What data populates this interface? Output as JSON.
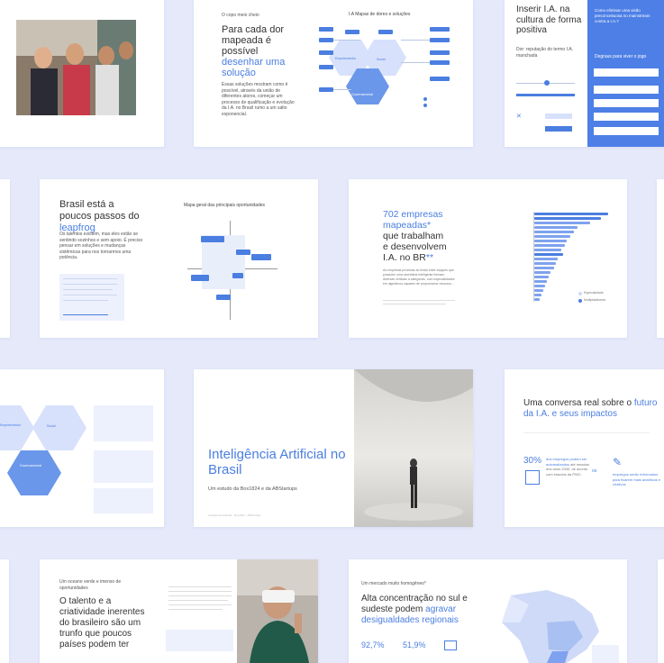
{
  "row1": {
    "card2": {
      "kicker": "O copo meio cheio",
      "title_a": "Para cada dor mapeada é possível ",
      "title_b": "desenhar uma solução",
      "body": "Essas soluções mostram como é possível, através da união de diferentes atores, começar um processo de qualificação e evolução da I.A. no Brasil rumo a um salto exponencial.",
      "map_title": "I.A Mapas de dores e soluções",
      "hex_labels": [
        "Empreendedor",
        "Social",
        "Governamental"
      ]
    },
    "card3": {
      "title": "Inserir I.A. na cultura de forma positiva",
      "sub": "Dor: reputação do termo I.A. manchada",
      "panel_title": "Como eliminar uma visão preconceituosa no mainstream contra a I.A.?",
      "panel_sub": "Degraus para viver o jogo"
    }
  },
  "row2": {
    "card_leapfrog": {
      "title_a": "Brasil está a poucos passos do ",
      "title_b": "leapfrog",
      "body": "Os talentos existem, mas eles estão se sentindo sozinhos e sem apoio. É preciso pensar em soluções e mudanças sistêmicas para nos tornarmos uma potência.",
      "map_title": "Mapa geral das principais oportunidades"
    },
    "card_companies": {
      "title_a": "702 empresas mapeadas*",
      "title_b": " que trabalham e desenvolvem I.A. no BR",
      "title_c": "**",
      "body": "As empresas próximas ao limiar entre equipes que possuem uma secretária Inteligente formam diversas verticais a categorias, com especialidades em algoritmos capazes de proporcionar recursos…",
      "legend": [
        "Especialidade",
        "Multiplataforma"
      ]
    }
  },
  "row3": {
    "card_hex": {
      "labels": [
        "Empreendedor",
        "Social",
        "Governamental"
      ]
    },
    "cover": {
      "title": "Inteligência Artificial no Brasil",
      "subtitle": "Um estudo da Box1824 e da ABStartups",
      "footer": "Inteligência Artificial · Box1824 · ABStartups"
    },
    "card_conversa": {
      "title_a": "Uma conversa real sobre o ",
      "title_b": "futuro da I.A. e seus impactos",
      "stat_value": "30%",
      "stat_a": "dos empregos podem ser automatizados",
      "stat_b": "até meados dos anos 2030, de acordo com estudos da PWC.",
      "stat2": "empregos serão reformados para ficarem mais analíticos e criativos"
    }
  },
  "row4": {
    "card_talent": {
      "kicker": "Um oceano verde e imenso de oportunidades",
      "title": "O talento e a criatividade inerentes do brasileiro são um trunfo que poucos países podem ter"
    },
    "card_region": {
      "kicker": "Um mercado muito homogêneo*",
      "title_a": "Alta concentração no sul e sudeste podem ",
      "title_b": "agravar desigualdades regionais",
      "stat1": "92,7%",
      "stat2": "51,9%"
    }
  },
  "colors": {
    "accent": "#4a7ee0",
    "background": "#e5e9fa",
    "panel": "#4d7fe6"
  }
}
